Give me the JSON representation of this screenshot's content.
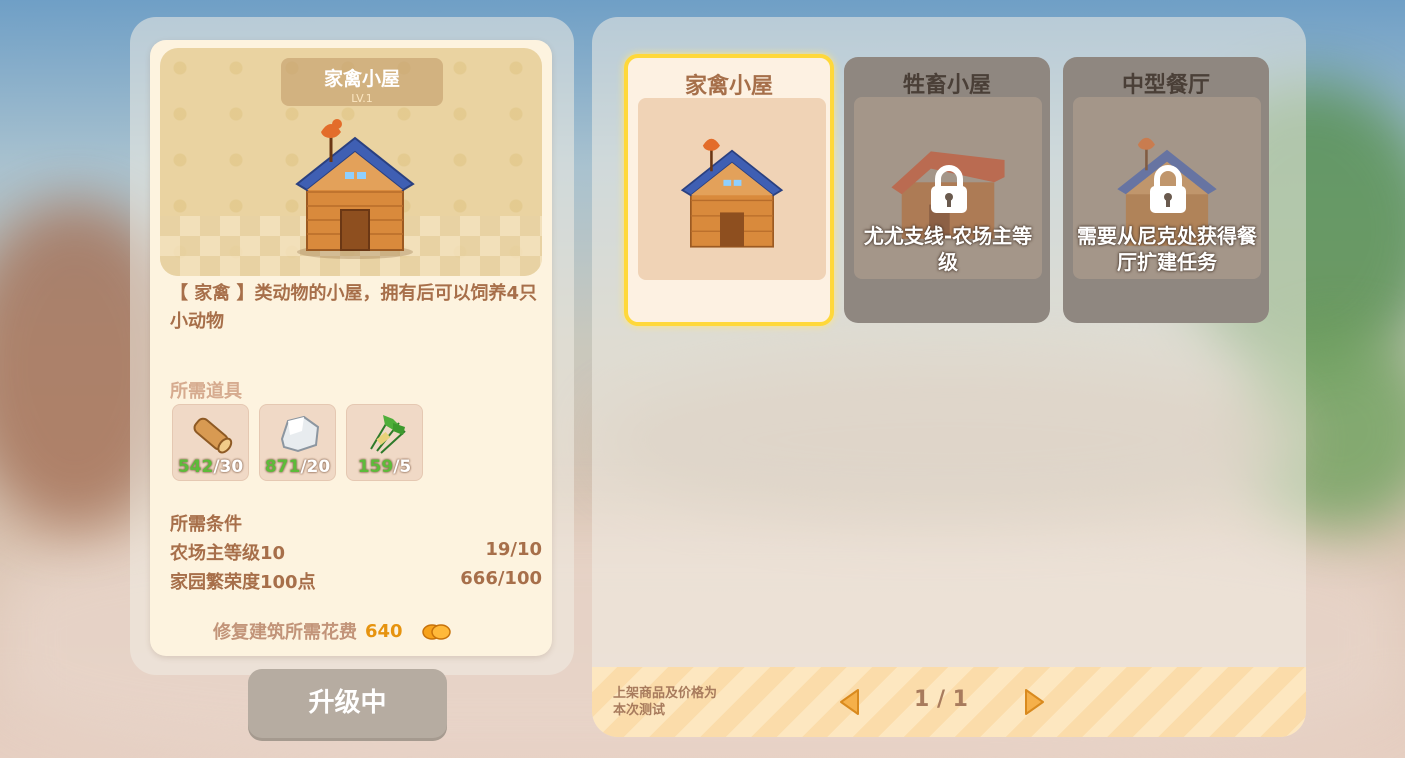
{
  "building_detail": {
    "name": "家禽小屋",
    "level": "LV.1",
    "description": "【 家禽 】类动物的小屋，拥有后可以饲养4只小动物",
    "required_items_label": "所需道具",
    "required_items": [
      {
        "icon": "wood-log-icon",
        "have": "542",
        "need": "/30"
      },
      {
        "icon": "stone-icon",
        "have": "871",
        "need": "/20"
      },
      {
        "icon": "grass-bundle-icon",
        "have": "159",
        "need": "/5"
      }
    ],
    "conditions_label": "所需条件",
    "conditions": [
      {
        "label": "农场主等级10",
        "value": "19/10"
      },
      {
        "label": "家园繁荣度100点",
        "value": "666/100"
      }
    ],
    "cost_label": "修复建筑所需花费",
    "cost_value": "640",
    "cost_icon": "coin-icon"
  },
  "upgrade_button": {
    "label": "升级中"
  },
  "cards": [
    {
      "title": "家禽小屋",
      "selected": true,
      "locked": false
    },
    {
      "title": "牲畜小屋",
      "selected": false,
      "locked": true,
      "lock_text": "尤尤支线-农场主等级"
    },
    {
      "title": "中型餐厅",
      "selected": false,
      "locked": true,
      "lock_text": "需要从尼克处获得餐厅扩建任务"
    }
  ],
  "footer": {
    "note": "上架商品及价格为本次测试",
    "page": "1 / 1"
  },
  "colors": {
    "accent_text": "#a76f4a",
    "have_green": "#5dbb3a",
    "cost_orange": "#e6930f",
    "selected_border": "#ffd83a"
  }
}
